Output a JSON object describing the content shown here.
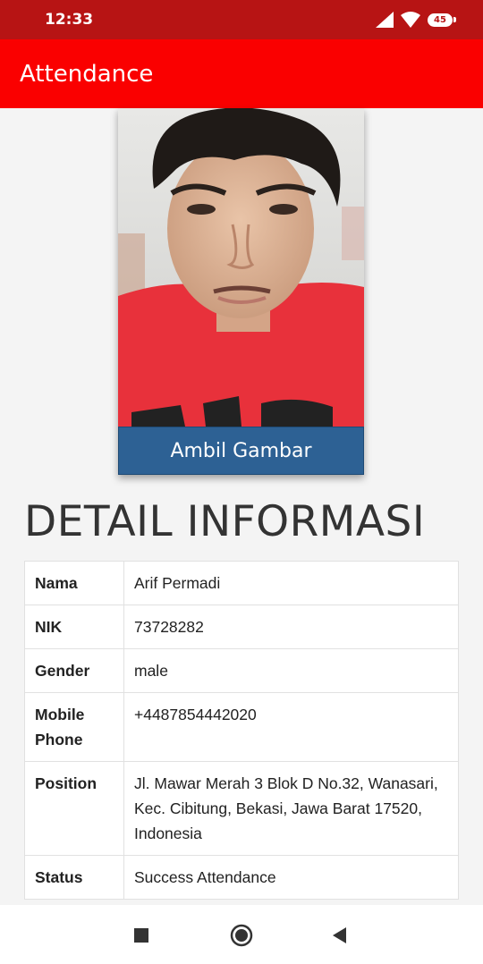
{
  "status_bar": {
    "time": "12:33",
    "battery": "45"
  },
  "app_bar": {
    "title": "Attendance"
  },
  "photo": {
    "button_label": "Ambil Gambar"
  },
  "detail": {
    "heading": "DETAIL INFORMASI",
    "rows": [
      {
        "label": "Nama",
        "value": "Arif Permadi"
      },
      {
        "label": "NIK",
        "value": "73728282"
      },
      {
        "label": "Gender",
        "value": "male"
      },
      {
        "label": "Mobile Phone",
        "value": "+4487854442020"
      },
      {
        "label": "Position",
        "value": "Jl. Mawar Merah 3 Blok D No.32, Wanasari, Kec. Cibitung, Bekasi, Jawa Barat 17520, Indonesia"
      },
      {
        "label": "Status",
        "value": "Success Attendance"
      }
    ]
  },
  "colors": {
    "status_bar": "#b71414",
    "app_bar": "#fa0000",
    "button": "#2d6194"
  },
  "icons": [
    "signal-icon",
    "wifi-icon",
    "battery-icon",
    "recent-apps-icon",
    "home-icon",
    "back-icon"
  ]
}
